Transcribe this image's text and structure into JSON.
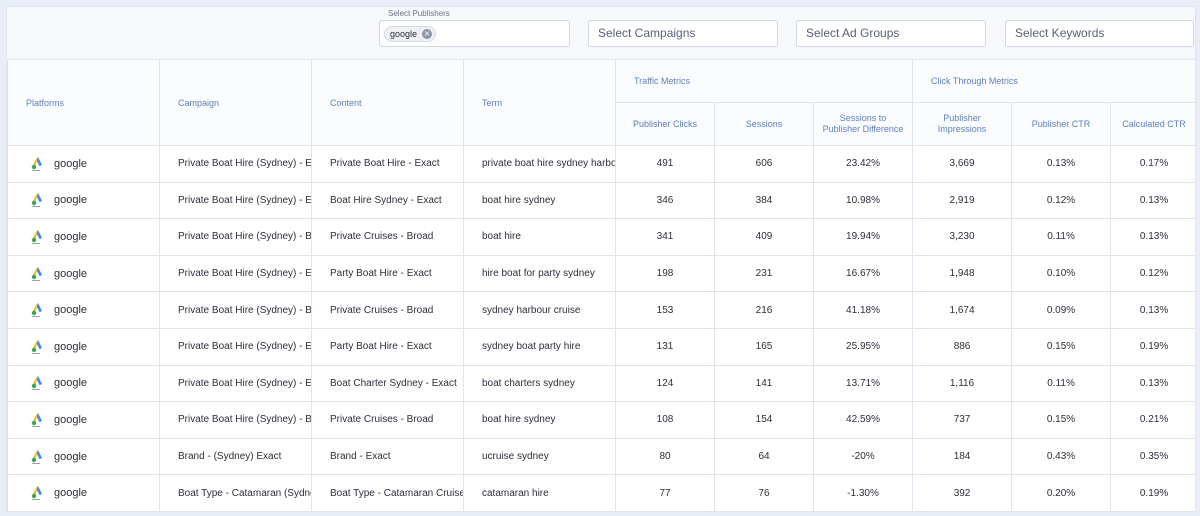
{
  "filters": {
    "publishers_label": "Select Publishers",
    "publishers_chip": "google",
    "campaigns_placeholder": "Select Campaigns",
    "adgroups_placeholder": "Select Ad Groups",
    "keywords_placeholder": "Select Keywords"
  },
  "headers": {
    "platforms": "Platforms",
    "campaign": "Campaign",
    "content": "Content",
    "term": "Term",
    "traffic_group": "Traffic Metrics",
    "ctr_group": "Click Through Metrics",
    "publisher_clicks": "Publisher Clicks",
    "sessions": "Sessions",
    "sessions_diff": "Sessions to Publisher Difference",
    "publisher_impressions": "Publisher Impressions",
    "publisher_ctr": "Publisher CTR",
    "calculated_ctr": "Calculated CTR"
  },
  "icon": "google-ads-icon",
  "rows": [
    {
      "platform": "google",
      "campaign": "Private Boat Hire (Sydney) - Exact",
      "content": "Private Boat Hire - Exact",
      "term": "private boat hire sydney harbour",
      "clicks": "491",
      "sessions": "606",
      "diff": "23.42%",
      "impressions": "3,669",
      "pub_ctr": "0.13%",
      "calc_ctr": "0.17%"
    },
    {
      "platform": "google",
      "campaign": "Private Boat Hire (Sydney) - Exact",
      "content": "Boat Hire Sydney - Exact",
      "term": "boat hire sydney",
      "clicks": "346",
      "sessions": "384",
      "diff": "10.98%",
      "impressions": "2,919",
      "pub_ctr": "0.12%",
      "calc_ctr": "0.13%"
    },
    {
      "platform": "google",
      "campaign": "Private Boat Hire (Sydney) - Broad",
      "content": "Private Cruises - Broad",
      "term": "boat hire",
      "clicks": "341",
      "sessions": "409",
      "diff": "19.94%",
      "impressions": "3,230",
      "pub_ctr": "0.11%",
      "calc_ctr": "0.13%"
    },
    {
      "platform": "google",
      "campaign": "Private Boat Hire (Sydney) - Exact",
      "content": "Party Boat Hire - Exact",
      "term": "hire boat for party sydney",
      "clicks": "198",
      "sessions": "231",
      "diff": "16.67%",
      "impressions": "1,948",
      "pub_ctr": "0.10%",
      "calc_ctr": "0.12%"
    },
    {
      "platform": "google",
      "campaign": "Private Boat Hire (Sydney) - Broad",
      "content": "Private Cruises - Broad",
      "term": "sydney harbour cruise",
      "clicks": "153",
      "sessions": "216",
      "diff": "41.18%",
      "impressions": "1,674",
      "pub_ctr": "0.09%",
      "calc_ctr": "0.13%"
    },
    {
      "platform": "google",
      "campaign": "Private Boat Hire (Sydney) - Exact",
      "content": "Party Boat Hire - Exact",
      "term": "sydney boat party hire",
      "clicks": "131",
      "sessions": "165",
      "diff": "25.95%",
      "impressions": "886",
      "pub_ctr": "0.15%",
      "calc_ctr": "0.19%"
    },
    {
      "platform": "google",
      "campaign": "Private Boat Hire (Sydney) - Exact",
      "content": "Boat Charter Sydney - Exact",
      "term": "boat charters sydney",
      "clicks": "124",
      "sessions": "141",
      "diff": "13.71%",
      "impressions": "1,116",
      "pub_ctr": "0.11%",
      "calc_ctr": "0.13%"
    },
    {
      "platform": "google",
      "campaign": "Private Boat Hire (Sydney) - Broad",
      "content": "Private Cruises - Broad",
      "term": "boat hire sydney",
      "clicks": "108",
      "sessions": "154",
      "diff": "42.59%",
      "impressions": "737",
      "pub_ctr": "0.15%",
      "calc_ctr": "0.21%"
    },
    {
      "platform": "google",
      "campaign": "Brand - (Sydney) Exact",
      "content": "Brand - Exact",
      "term": "ucruise sydney",
      "clicks": "80",
      "sessions": "64",
      "diff": "-20%",
      "impressions": "184",
      "pub_ctr": "0.43%",
      "calc_ctr": "0.35%"
    },
    {
      "platform": "google",
      "campaign": "Boat Type - Catamaran (Sydney)",
      "content": "Boat Type - Catamaran Cruises",
      "term": "catamaran hire",
      "clicks": "77",
      "sessions": "76",
      "diff": "-1.30%",
      "impressions": "392",
      "pub_ctr": "0.20%",
      "calc_ctr": "0.19%"
    }
  ]
}
